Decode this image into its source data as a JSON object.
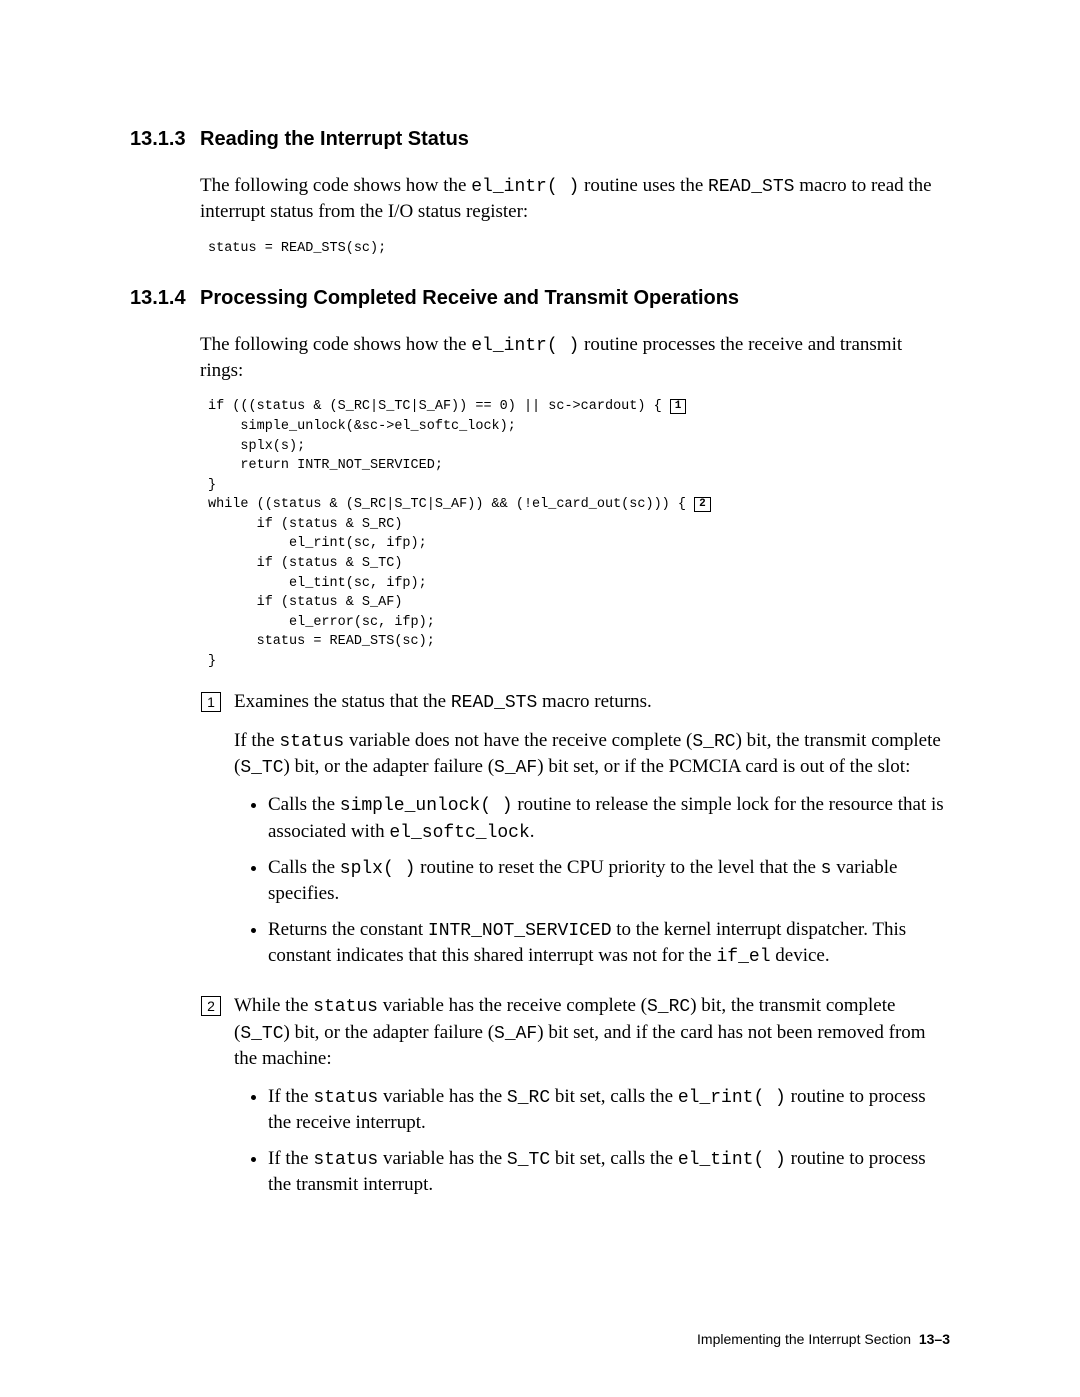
{
  "sections": {
    "s1": {
      "number": "13.1.3",
      "title": "Reading the Interrupt Status",
      "intro_pre": "The following code shows how the ",
      "intro_code1": "el_intr( )",
      "intro_mid": " routine uses the ",
      "intro_code2": "READ_STS",
      "intro_post": " macro to read the interrupt status from the I/O status register:",
      "code": "status = READ_STS(sc);"
    },
    "s2": {
      "number": "13.1.4",
      "title": "Processing Completed Receive and Transmit Operations",
      "intro_pre": "The following code shows how the ",
      "intro_code": "el_intr( )",
      "intro_post": " routine processes the receive and transmit rings:",
      "code_line1": "if (((status & (S_RC|S_TC|S_AF)) == 0) || sc->cardout) { ",
      "code_block1": "    simple_unlock(&sc->el_softc_lock);\n    splx(s);\n    return INTR_NOT_SERVICED;\n}",
      "code_line2": "while ((status & (S_RC|S_TC|S_AF)) && (!el_card_out(sc))) { ",
      "code_block2": "      if (status & S_RC)\n          el_rint(sc, ifp);\n      if (status & S_TC)\n          el_tint(sc, ifp);\n      if (status & S_AF)\n          el_error(sc, ifp);\n      status = READ_STS(sc);\n}",
      "callout1_marker": "1",
      "callout2_marker": "2"
    }
  },
  "callouts": {
    "c1": {
      "num": "1",
      "p1_a": "Examines the status that the ",
      "p1_code": "READ_STS",
      "p1_b": " macro returns.",
      "p2_a": "If the ",
      "p2_code1": "status",
      "p2_b": " variable does not have the receive complete (",
      "p2_code2": "S_RC",
      "p2_c": ") bit, the transmit complete (",
      "p2_code3": "S_TC",
      "p2_d": ") bit, or the adapter failure (",
      "p2_code4": "S_AF",
      "p2_e": ") bit set, or if the PCMCIA card is out of the slot:",
      "b1_a": "Calls the ",
      "b1_code1": "simple_unlock( )",
      "b1_b": " routine to release the simple lock for the resource that is associated with ",
      "b1_code2": "el_softc_lock",
      "b1_c": ".",
      "b2_a": "Calls the ",
      "b2_code1": "splx( )",
      "b2_b": " routine to reset the CPU priority to the level that the ",
      "b2_code2": "s",
      "b2_c": " variable specifies.",
      "b3_a": "Returns the constant ",
      "b3_code1": "INTR_NOT_SERVICED",
      "b3_b": " to the kernel interrupt dispatcher. This constant indicates that this shared interrupt was not for the ",
      "b3_code2": "if_el",
      "b3_c": " device."
    },
    "c2": {
      "num": "2",
      "p1_a": "While the ",
      "p1_code1": "status",
      "p1_b": " variable has the receive complete (",
      "p1_code2": "S_RC",
      "p1_c": ") bit, the transmit complete (",
      "p1_code3": "S_TC",
      "p1_d": ") bit, or the adapter failure (",
      "p1_code4": "S_AF",
      "p1_e": ") bit set, and if the card has not been removed from the machine:",
      "b1_a": "If the ",
      "b1_code1": "status",
      "b1_b": " variable has the ",
      "b1_code2": "S_RC",
      "b1_c": " bit set, calls the ",
      "b1_code3": "el_rint( )",
      "b1_d": " routine to process the receive interrupt.",
      "b2_a": "If the ",
      "b2_code1": "status",
      "b2_b": " variable has the ",
      "b2_code2": "S_TC",
      "b2_c": " bit set, calls the ",
      "b2_code3": "el_tint( )",
      "b2_d": " routine to process the transmit interrupt."
    }
  },
  "footer": {
    "title": "Implementing the Interrupt Section",
    "page": "13–3"
  }
}
